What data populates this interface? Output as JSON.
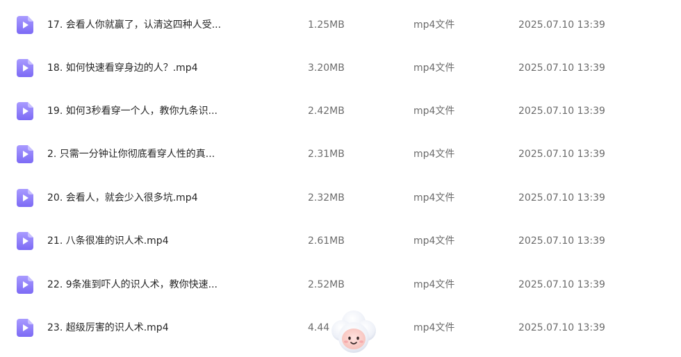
{
  "files": [
    {
      "name": "17. 会看人你就赢了，认清这四种人受...",
      "size": "1.25MB",
      "type": "mp4文件",
      "date": "2025.07.10 13:39",
      "icon": "video-file-icon"
    },
    {
      "name": "18. 如何快速看穿身边的人？.mp4",
      "size": "3.20MB",
      "type": "mp4文件",
      "date": "2025.07.10 13:39",
      "icon": "video-file-icon"
    },
    {
      "name": "19. 如何3秒看穿一个人，教你九条识...",
      "size": "2.42MB",
      "type": "mp4文件",
      "date": "2025.07.10 13:39",
      "icon": "video-file-icon"
    },
    {
      "name": "2. 只需一分钟让你彻底看穿人性的真...",
      "size": "2.31MB",
      "type": "mp4文件",
      "date": "2025.07.10 13:39",
      "icon": "video-file-icon"
    },
    {
      "name": "20. 会看人，就会少入很多坑.mp4",
      "size": "2.32MB",
      "type": "mp4文件",
      "date": "2025.07.10 13:39",
      "icon": "video-file-icon"
    },
    {
      "name": "21. 八条很准的识人术.mp4",
      "size": "2.61MB",
      "type": "mp4文件",
      "date": "2025.07.10 13:39",
      "icon": "video-file-icon"
    },
    {
      "name": "22. 9条准到吓人的识人术，教你快速...",
      "size": "2.52MB",
      "type": "mp4文件",
      "date": "2025.07.10 13:39",
      "icon": "video-file-icon"
    },
    {
      "name": "23. 超级厉害的识人术.mp4",
      "size": "4.44",
      "type": "mp4文件",
      "date": "2025.07.10 13:39",
      "icon": "video-file-icon"
    }
  ],
  "colors": {
    "icon_top": "#a99bff",
    "icon_bottom": "#7c6af5",
    "name_text": "#252525",
    "meta_text": "#6b6b6b"
  },
  "assistant_icon": "cloud-assistant-icon"
}
